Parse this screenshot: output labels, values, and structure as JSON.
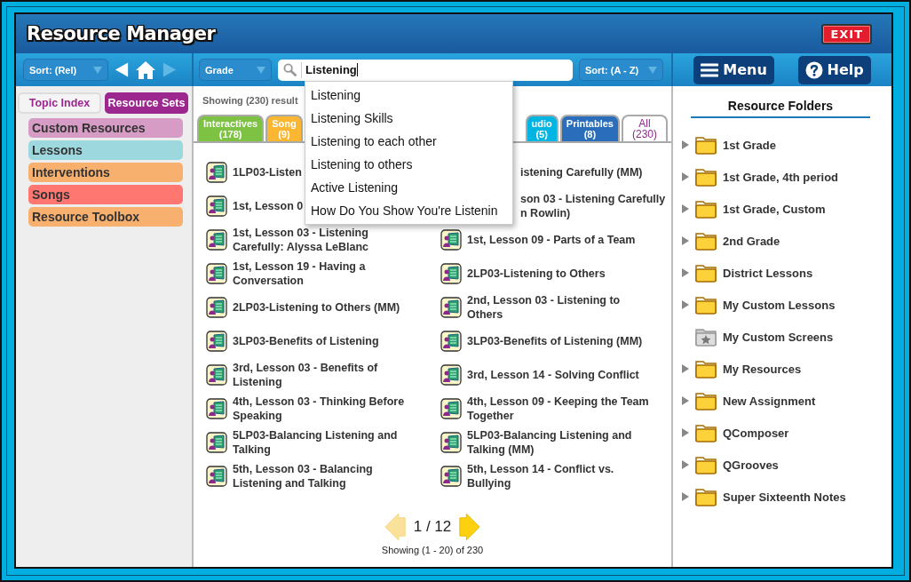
{
  "window": {
    "title": "Resource Manager",
    "exit_button": "EXIT"
  },
  "toolbar": {
    "sort_left": "Sort: (Rel)",
    "grade": "Grade",
    "search": {
      "value": "Listening"
    },
    "sort_right": "Sort: (A - Z)",
    "menu_button": "Menu",
    "help_button": "Help"
  },
  "suggestions": [
    "Listening",
    "Listening Skills",
    "Listening to each other",
    "Listening to others",
    "Active Listening",
    "How Do You Show You're Listenin"
  ],
  "sidebar": {
    "tabs": [
      {
        "label": "Topic Index",
        "selected": false
      },
      {
        "label": "Resource Sets",
        "selected": true
      }
    ],
    "items": [
      {
        "label": "Custom Resources",
        "color": "#d69cc6"
      },
      {
        "label": "Lessons",
        "color": "#9ed8df"
      },
      {
        "label": "Interventions",
        "color": "#f8b06f"
      },
      {
        "label": "Songs",
        "color": "#ff7770"
      },
      {
        "label": "Resource Toolbox",
        "color": "#f8b06f"
      }
    ]
  },
  "results": {
    "summary": "Showing (230) result",
    "tabs": [
      {
        "label": "Interactives",
        "count": "(178)",
        "color": "#7dc242",
        "selected": false
      },
      {
        "label": "Song",
        "count": "(9)",
        "color": "#fbb632",
        "selected": false
      },
      {
        "label": "udio",
        "count": "(5)",
        "color": "#00b5e2",
        "selected": false
      },
      {
        "label": "Printables",
        "count": "(8)",
        "color": "#2a6ebb",
        "selected": false
      },
      {
        "label": "All",
        "count": "(230)",
        "color": "#ffffff",
        "selected": true
      }
    ],
    "items": [
      {
        "title": "1LP03-Listen",
        "icon_visible": true
      },
      {
        "title": "istening Carefully (MM)",
        "icon_visible": false
      },
      {
        "title": "1st, Lesson 0",
        "icon_visible": true
      },
      {
        "title": "son 03 - Listening Carefully\nn Rowlin)",
        "icon_visible": false
      },
      {
        "title": "1st, Lesson 03 - Listening Carefully: Alyssa LeBlanc",
        "icon_visible": true
      },
      {
        "title": "1st, Lesson 09 - Parts of a Team",
        "icon_visible": true
      },
      {
        "title": "1st, Lesson 19 - Having a Conversation",
        "icon_visible": true
      },
      {
        "title": "2LP03-Listening to Others",
        "icon_visible": true
      },
      {
        "title": "2LP03-Listening to Others (MM)",
        "icon_visible": true
      },
      {
        "title": "2nd, Lesson 03 - Listening to Others",
        "icon_visible": true
      },
      {
        "title": "3LP03-Benefits of Listening",
        "icon_visible": true
      },
      {
        "title": "3LP03-Benefits of Listening (MM)",
        "icon_visible": true
      },
      {
        "title": "3rd, Lesson 03 - Benefits of Listening",
        "icon_visible": true
      },
      {
        "title": "3rd, Lesson 14 - Solving Conflict",
        "icon_visible": true
      },
      {
        "title": "4th, Lesson 03 - Thinking Before Speaking",
        "icon_visible": true
      },
      {
        "title": "4th, Lesson 09 - Keeping the Team Together",
        "icon_visible": true
      },
      {
        "title": "5LP03-Balancing Listening and Talking",
        "icon_visible": true
      },
      {
        "title": "5LP03-Balancing Listening and Talking (MM)",
        "icon_visible": true
      },
      {
        "title": "5th, Lesson 03 - Balancing Listening and Talking",
        "icon_visible": true
      },
      {
        "title": "5th, Lesson 14 - Conflict vs. Bullying",
        "icon_visible": true
      }
    ]
  },
  "pagination": {
    "page": "1 / 12",
    "summary": "Showing (1 - 20) of 230"
  },
  "folders": {
    "title": "Resource Folders",
    "items": [
      {
        "name": "1st Grade",
        "kind": "folder"
      },
      {
        "name": "1st Grade, 4th period",
        "kind": "folder"
      },
      {
        "name": "1st Grade, Custom",
        "kind": "folder"
      },
      {
        "name": "2nd Grade",
        "kind": "folder"
      },
      {
        "name": "District Lessons",
        "kind": "folder"
      },
      {
        "name": "My Custom Lessons",
        "kind": "folder"
      },
      {
        "name": "My Custom Screens",
        "kind": "starred"
      },
      {
        "name": "My Resources",
        "kind": "folder"
      },
      {
        "name": "New Assignment",
        "kind": "folder"
      },
      {
        "name": "QComposer",
        "kind": "folder"
      },
      {
        "name": "QGrooves",
        "kind": "folder"
      },
      {
        "name": "Super Sixteenth Notes",
        "kind": "folder"
      }
    ]
  }
}
